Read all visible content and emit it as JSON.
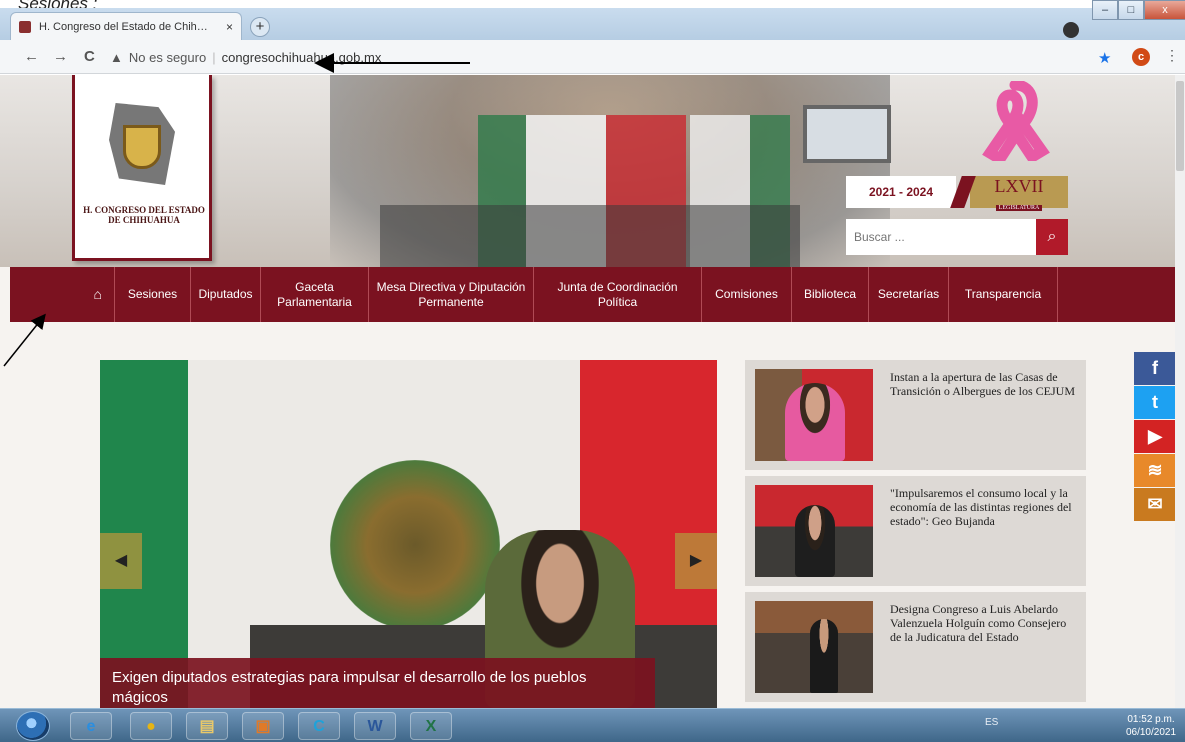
{
  "caption": "Sesiones :",
  "browser": {
    "tab_title": "H. Congreso del Estado de Chih…",
    "tab_close": "×",
    "new_tab": "+",
    "back": "←",
    "forward": "→",
    "reload": "C",
    "security_icon": "▲",
    "security_text": "No es seguro",
    "url": "congresochihuahua.gob.mx",
    "bookmark": "★",
    "profile_initial": "c",
    "menu": "⋮",
    "win_minimize": "–",
    "win_maximize": "□",
    "win_close": "x"
  },
  "header": {
    "org_name": "H. CONGRESO DEL ESTADO DE CHIHUAHUA",
    "years": "2021 - 2024",
    "legislatura_num": "LXVII",
    "legislatura_label": "LEGISLATURA",
    "search_placeholder": "Buscar ...",
    "search_icon": "⌕"
  },
  "nav": {
    "home_icon": "⌂",
    "items": [
      {
        "label": "Sesiones"
      },
      {
        "label": "Diputados"
      },
      {
        "label": "Gaceta Parlamentaria"
      },
      {
        "label": "Mesa Directiva y Diputación Permanente"
      },
      {
        "label": "Junta de Coordinación Política"
      },
      {
        "label": "Comisiones"
      },
      {
        "label": "Biblioteca"
      },
      {
        "label": "Secretarías"
      },
      {
        "label": "Transparencia"
      }
    ]
  },
  "slider": {
    "headline": "Exigen diputados estrategias para impulsar el desarrollo de los pueblos mágicos",
    "prev": "◀",
    "next": "▶"
  },
  "news": [
    {
      "text": "Instan a la apertura de las Casas de Transición o Albergues de los CEJUM"
    },
    {
      "text": "\"Impulsaremos el consumo local y la economía de las distintas regiones del estado\": Geo Bujanda"
    },
    {
      "text": "Designa Congreso a Luis Abelardo Valenzuela Holguín como Consejero de la Judicatura del Estado"
    }
  ],
  "social": [
    {
      "icon": "f",
      "color": "#3b5998"
    },
    {
      "icon": "t",
      "color": "#1da1f2"
    },
    {
      "icon": "▶",
      "color": "#d32323"
    },
    {
      "icon": "≋",
      "color": "#e8892a"
    },
    {
      "icon": "✉",
      "color": "#c97a1f"
    }
  ],
  "taskbar": {
    "tray_lang": "ES",
    "time": "01:52 p.m.",
    "date": "06/10/2021",
    "apps": [
      {
        "icon": "e",
        "color": "#2a8ee0"
      },
      {
        "icon": "●",
        "color": "#e6b413"
      },
      {
        "icon": "▤",
        "color": "#e8c86a"
      },
      {
        "icon": "▣",
        "color": "#e07a28"
      },
      {
        "icon": "C",
        "color": "#1fa2d9"
      },
      {
        "icon": "W",
        "color": "#2b579a"
      },
      {
        "icon": "X",
        "color": "#217346"
      }
    ]
  }
}
